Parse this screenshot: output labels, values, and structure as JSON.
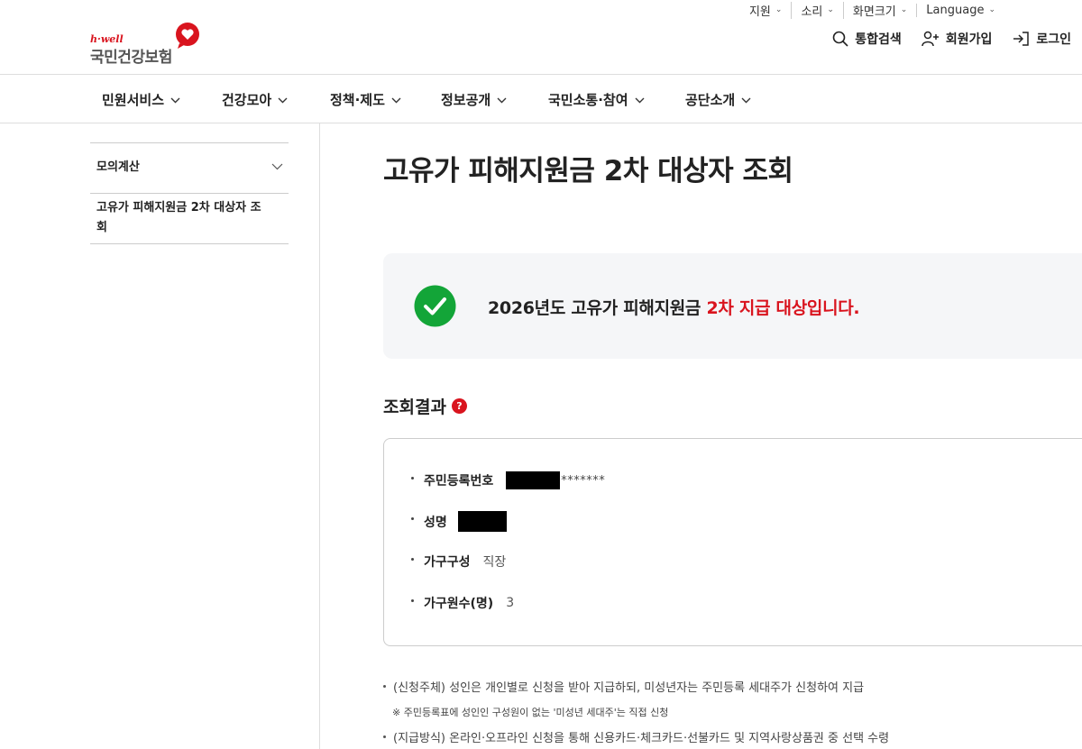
{
  "utility_bar": {
    "items": [
      {
        "label": "지원"
      },
      {
        "label": "소리"
      },
      {
        "label": "화면크기"
      },
      {
        "label": "Language"
      }
    ]
  },
  "header": {
    "logo_hwell": "h·well",
    "logo_name": "국민건강보험",
    "search_label": "통합검색",
    "join_label": "회원가입",
    "login_label": "로그인"
  },
  "gnb": {
    "items": [
      {
        "label": "민원서비스"
      },
      {
        "label": "건강모아"
      },
      {
        "label": "정책·제도"
      },
      {
        "label": "정보공개"
      },
      {
        "label": "국민소통·참여"
      },
      {
        "label": "공단소개"
      }
    ]
  },
  "sidebar": {
    "items": [
      {
        "label": "모의계산"
      },
      {
        "label": "고유가 피해지원금 2차 대상자 조회"
      }
    ]
  },
  "main": {
    "title": "고유가 피해지원금 2차 대상자 조회",
    "banner": {
      "prefix": "2026년도 고유가 피해지원금 ",
      "highlight": "2차 지급 대상입니다."
    },
    "section_title": "조회결과",
    "help_icon": "?",
    "info": {
      "rrn_label": "주민등록번호",
      "rrn_masked": "*******",
      "name_label": "성명",
      "household_type_label": "가구구성",
      "household_type_value": "직장",
      "household_count_label": "가구원수(명)",
      "household_count_value": "3"
    },
    "notes": [
      "(신청주체) 성인은 개인별로 신청을 받아 지급하되, 미성년자는 주민등록 세대주가 신청하여 지급",
      "※ 주민등록표에 성인인 구성원이 없는 '미성년 세대주'는 직접 신청",
      "(지급방식) 온라인·오프라인 신청을 통해 신용카드·체크카드·선불카드 및 지역사랑상품권 중 선택 수령"
    ]
  },
  "colors": {
    "brand_red": "#d9141e",
    "success_green": "#13a538",
    "banner_bg": "#f5f6f8"
  }
}
